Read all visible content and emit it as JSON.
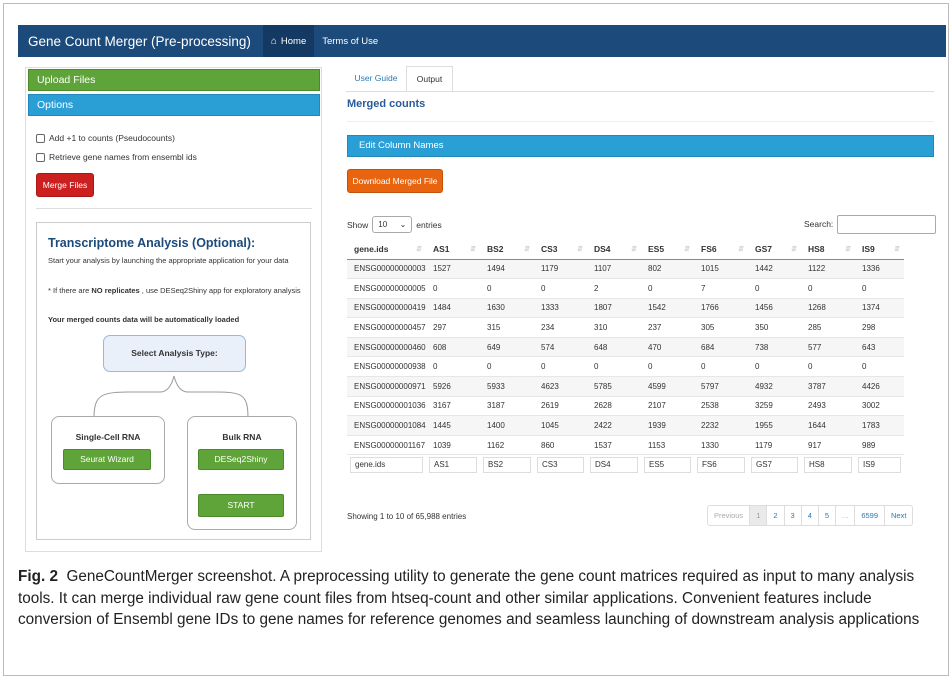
{
  "app": {
    "title": "Gene Count Merger (Pre-processing)",
    "nav": {
      "home": "Home",
      "terms": "Terms of Use"
    }
  },
  "sidebar": {
    "upload_header": "Upload Files",
    "options_header": "Options",
    "checkboxes": [
      {
        "label": "Add +1 to counts (Pseudocounts)",
        "checked": false
      },
      {
        "label": "Retrieve gene names from ensembl ids",
        "checked": false
      }
    ],
    "merge_button": "Merge Files",
    "transcriptome": {
      "title": "Transcriptome Analysis (Optional):",
      "intro": "Start your analysis by launching the appropriate application for your data",
      "note_pre": "* If there are ",
      "note_bold": "NO replicates",
      "note_post": " , use DESeq2Shiny app for exploratory analysis",
      "loaded": "Your merged counts data will be automatically loaded",
      "select_label": "Select Analysis Type:",
      "single_cell": {
        "title": "Single-Cell RNA",
        "button": "Seurat Wizard"
      },
      "bulk": {
        "title": "Bulk RNA",
        "button": "DESeq2Shiny"
      },
      "start_button": "START"
    }
  },
  "main": {
    "tabs": [
      "User Guide",
      "Output"
    ],
    "active_tab": "Output",
    "merged_title": "Merged counts",
    "edit_header": "Edit Column Names",
    "download_button": "Download Merged File",
    "show_pre": "Show",
    "page_size": "10",
    "show_post": "entries",
    "search_label": "Search:",
    "search_value": "",
    "table": {
      "columns": [
        "gene.ids",
        "AS1",
        "BS2",
        "CS3",
        "DS4",
        "ES5",
        "FS6",
        "GS7",
        "HS8",
        "IS9"
      ],
      "rows": [
        [
          "ENSG00000000003",
          "1527",
          "1494",
          "1179",
          "1107",
          "802",
          "1015",
          "1442",
          "1122",
          "1336"
        ],
        [
          "ENSG00000000005",
          "0",
          "0",
          "0",
          "2",
          "0",
          "7",
          "0",
          "0",
          "0"
        ],
        [
          "ENSG00000000419",
          "1484",
          "1630",
          "1333",
          "1807",
          "1542",
          "1766",
          "1456",
          "1268",
          "1374"
        ],
        [
          "ENSG00000000457",
          "297",
          "315",
          "234",
          "310",
          "237",
          "305",
          "350",
          "285",
          "298"
        ],
        [
          "ENSG00000000460",
          "608",
          "649",
          "574",
          "648",
          "470",
          "684",
          "738",
          "577",
          "643"
        ],
        [
          "ENSG00000000938",
          "0",
          "0",
          "0",
          "0",
          "0",
          "0",
          "0",
          "0",
          "0"
        ],
        [
          "ENSG00000000971",
          "5926",
          "5933",
          "4623",
          "5785",
          "4599",
          "5797",
          "4932",
          "3787",
          "4426"
        ],
        [
          "ENSG00000001036",
          "3167",
          "3187",
          "2619",
          "2628",
          "2107",
          "2538",
          "3259",
          "2493",
          "3002"
        ],
        [
          "ENSG00000001084",
          "1445",
          "1400",
          "1045",
          "2422",
          "1939",
          "2232",
          "1955",
          "1644",
          "1783"
        ],
        [
          "ENSG00000001167",
          "1039",
          "1162",
          "860",
          "1537",
          "1153",
          "1330",
          "1179",
          "917",
          "989"
        ]
      ],
      "footer": [
        "gene.ids",
        "AS1",
        "BS2",
        "CS3",
        "DS4",
        "ES5",
        "FS6",
        "GS7",
        "HS8",
        "IS9"
      ]
    },
    "info": "Showing 1 to 10 of 65,988 entries",
    "pagination": [
      "Previous",
      "1",
      "2",
      "3",
      "4",
      "5",
      "...",
      "6599",
      "Next"
    ]
  },
  "caption": {
    "label": "Fig. 2",
    "text": "GeneCountMerger screenshot. A preprocessing utility to generate the gene count matrices required as input to many analysis tools. It can merge individual raw gene count files from htseq-count and other similar applications. Convenient features include conversion of Ensembl gene IDs to gene names for reference genomes and seamless launching of downstream analysis applications"
  },
  "colors": {
    "navbar": "#1c4a7a",
    "green": "#5fa439",
    "blue": "#2a9fd6",
    "red": "#cc1f1f",
    "orange": "#e8640f"
  },
  "icons": {
    "home": "home-icon",
    "sort": "sort-icon",
    "dropdown": "chevron-down-icon"
  }
}
